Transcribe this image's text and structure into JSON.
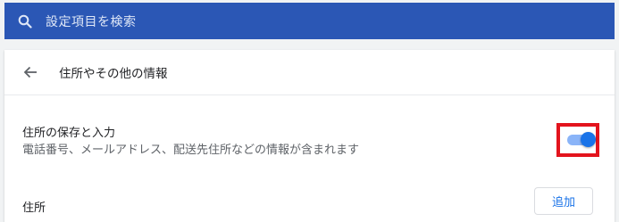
{
  "search": {
    "placeholder": "設定項目を検索",
    "icon": "search-icon"
  },
  "header": {
    "back_icon": "arrow-left-icon",
    "title": "住所やその他の情報"
  },
  "save_address": {
    "title": "住所の保存と入力",
    "description": "電話番号、メールアドレス、配送先住所などの情報が含まれます",
    "toggle_on": true,
    "highlight_color": "#e3141d"
  },
  "addresses": {
    "label": "住所",
    "add_button_label": "追加"
  },
  "colors": {
    "search_bar_bg": "#2b57b5",
    "accent": "#1a73e8"
  }
}
